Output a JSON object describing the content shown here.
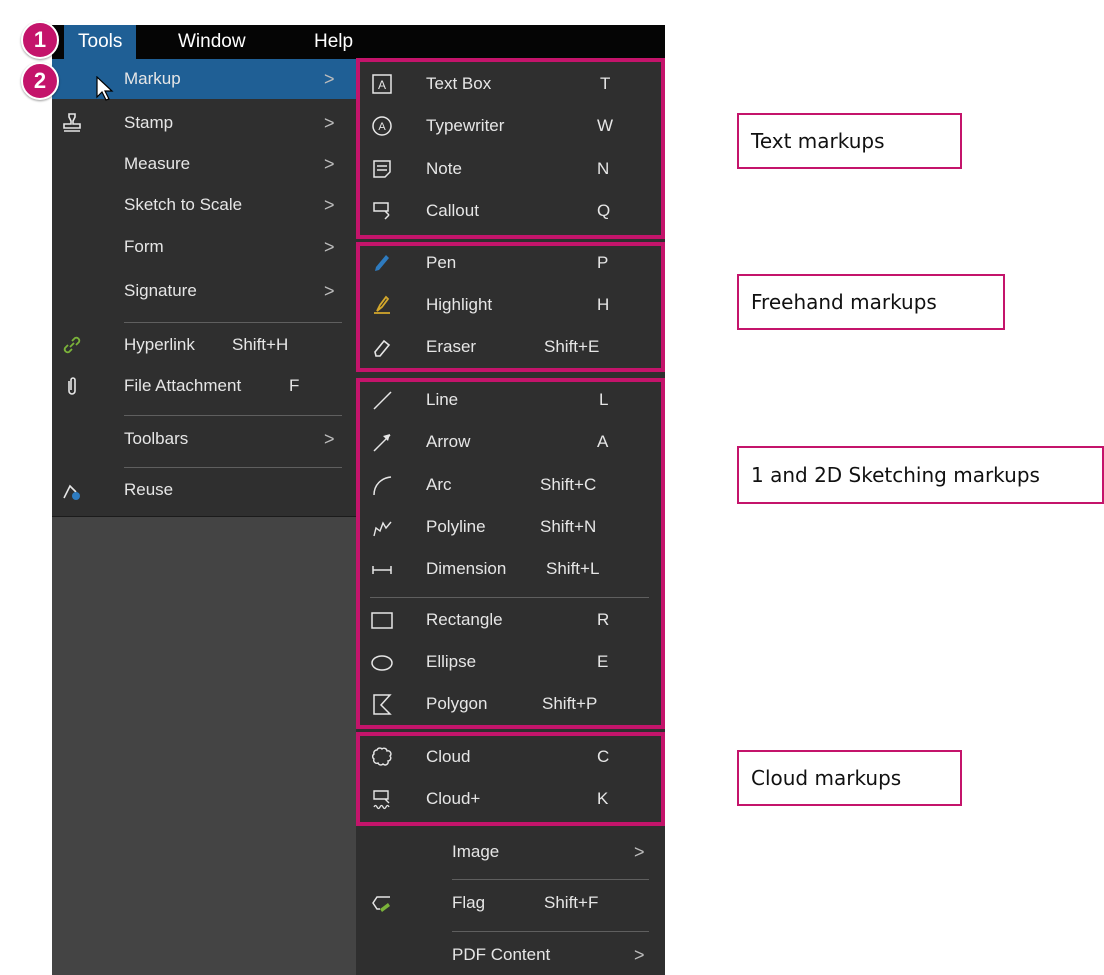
{
  "menubar": {
    "tools": "Tools",
    "window": "Window",
    "help": "Help"
  },
  "steps": {
    "one": "1",
    "two": "2"
  },
  "tools_menu": {
    "markup": "Markup",
    "stamp": "Stamp",
    "measure": "Measure",
    "sketch_to_scale": "Sketch to Scale",
    "form": "Form",
    "signature": "Signature",
    "hyperlink": "Hyperlink",
    "hyperlink_shortcut": "Shift+H",
    "file_attachment": "File Attachment",
    "file_attachment_shortcut": "F",
    "toolbars": "Toolbars",
    "reuse": "Reuse"
  },
  "markup_menu": {
    "text_box": "Text Box",
    "text_box_key": "T",
    "typewriter": "Typewriter",
    "typewriter_key": "W",
    "note": "Note",
    "note_key": "N",
    "callout": "Callout",
    "callout_key": "Q",
    "pen": "Pen",
    "pen_key": "P",
    "highlight": "Highlight",
    "highlight_key": "H",
    "eraser": "Eraser",
    "eraser_key": "Shift+E",
    "line": "Line",
    "line_key": "L",
    "arrow": "Arrow",
    "arrow_key": "A",
    "arc": "Arc",
    "arc_key": "Shift+C",
    "polyline": "Polyline",
    "polyline_key": "Shift+N",
    "dimension": "Dimension",
    "dimension_key": "Shift+L",
    "rectangle": "Rectangle",
    "rectangle_key": "R",
    "ellipse": "Ellipse",
    "ellipse_key": "E",
    "polygon": "Polygon",
    "polygon_key": "Shift+P",
    "cloud": "Cloud",
    "cloud_key": "C",
    "cloud_plus": "Cloud+",
    "cloud_plus_key": "K",
    "image": "Image",
    "flag": "Flag",
    "flag_key": "Shift+F",
    "pdf_content": "PDF Content"
  },
  "annotations": {
    "text_markups": "Text markups",
    "freehand_markups": "Freehand markups",
    "sketching_markups": "1 and 2D Sketching markups",
    "cloud_markups": "Cloud markups"
  },
  "colors": {
    "accent": "#c4146b",
    "menu_bg": "#2f2f2f",
    "highlight": "#1f5f95"
  },
  "chevron": ">"
}
